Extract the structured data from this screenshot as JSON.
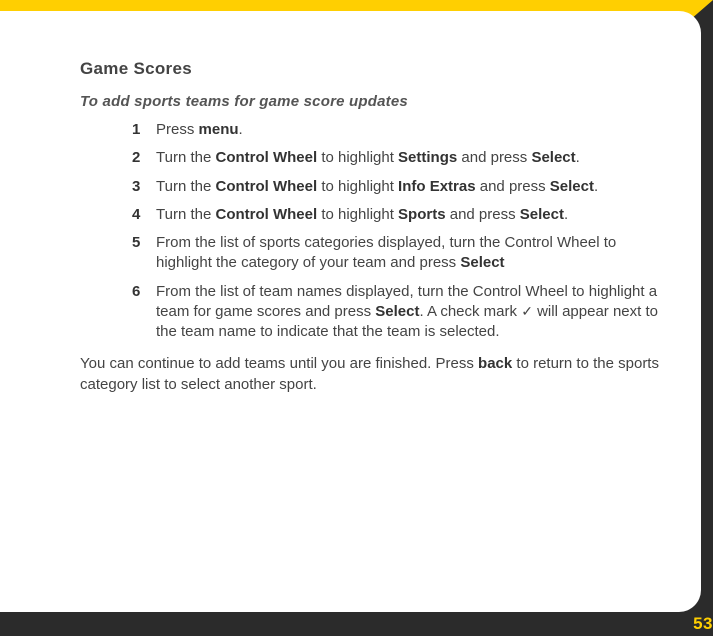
{
  "heading": "Game Scores",
  "subheading": "To add sports teams for game score updates",
  "steps": [
    {
      "num": "1",
      "html": "Press <b>menu</b>."
    },
    {
      "num": "2",
      "html": "Turn the <b>Control Wheel</b> to highlight <b>Settings</b> and press <b>Select</b>."
    },
    {
      "num": "3",
      "html": "Turn the <b>Control Wheel</b> to highlight <b>Info Extras</b> and press <b>Select</b>."
    },
    {
      "num": "4",
      "html": "Turn the <b>Control Wheel</b> to highlight <b>Sports</b> and press <b>Select</b>."
    },
    {
      "num": "5",
      "html": "From the list of sports categories displayed, turn the Control Wheel to highlight the category of your team and press <b>Select</b>"
    },
    {
      "num": "6",
      "html": "From the list of team names displayed, turn the Control Wheel to highlight a team for game scores and press <b>Select</b>. A check mark <span class=\"check\">✓</span> will appear next to the team name to indicate that the team is selected."
    }
  ],
  "closing_html": "You can continue to add teams until you are finished. Press <b>back</b> to return to the sports category list to select another sport.",
  "page_number": "53"
}
